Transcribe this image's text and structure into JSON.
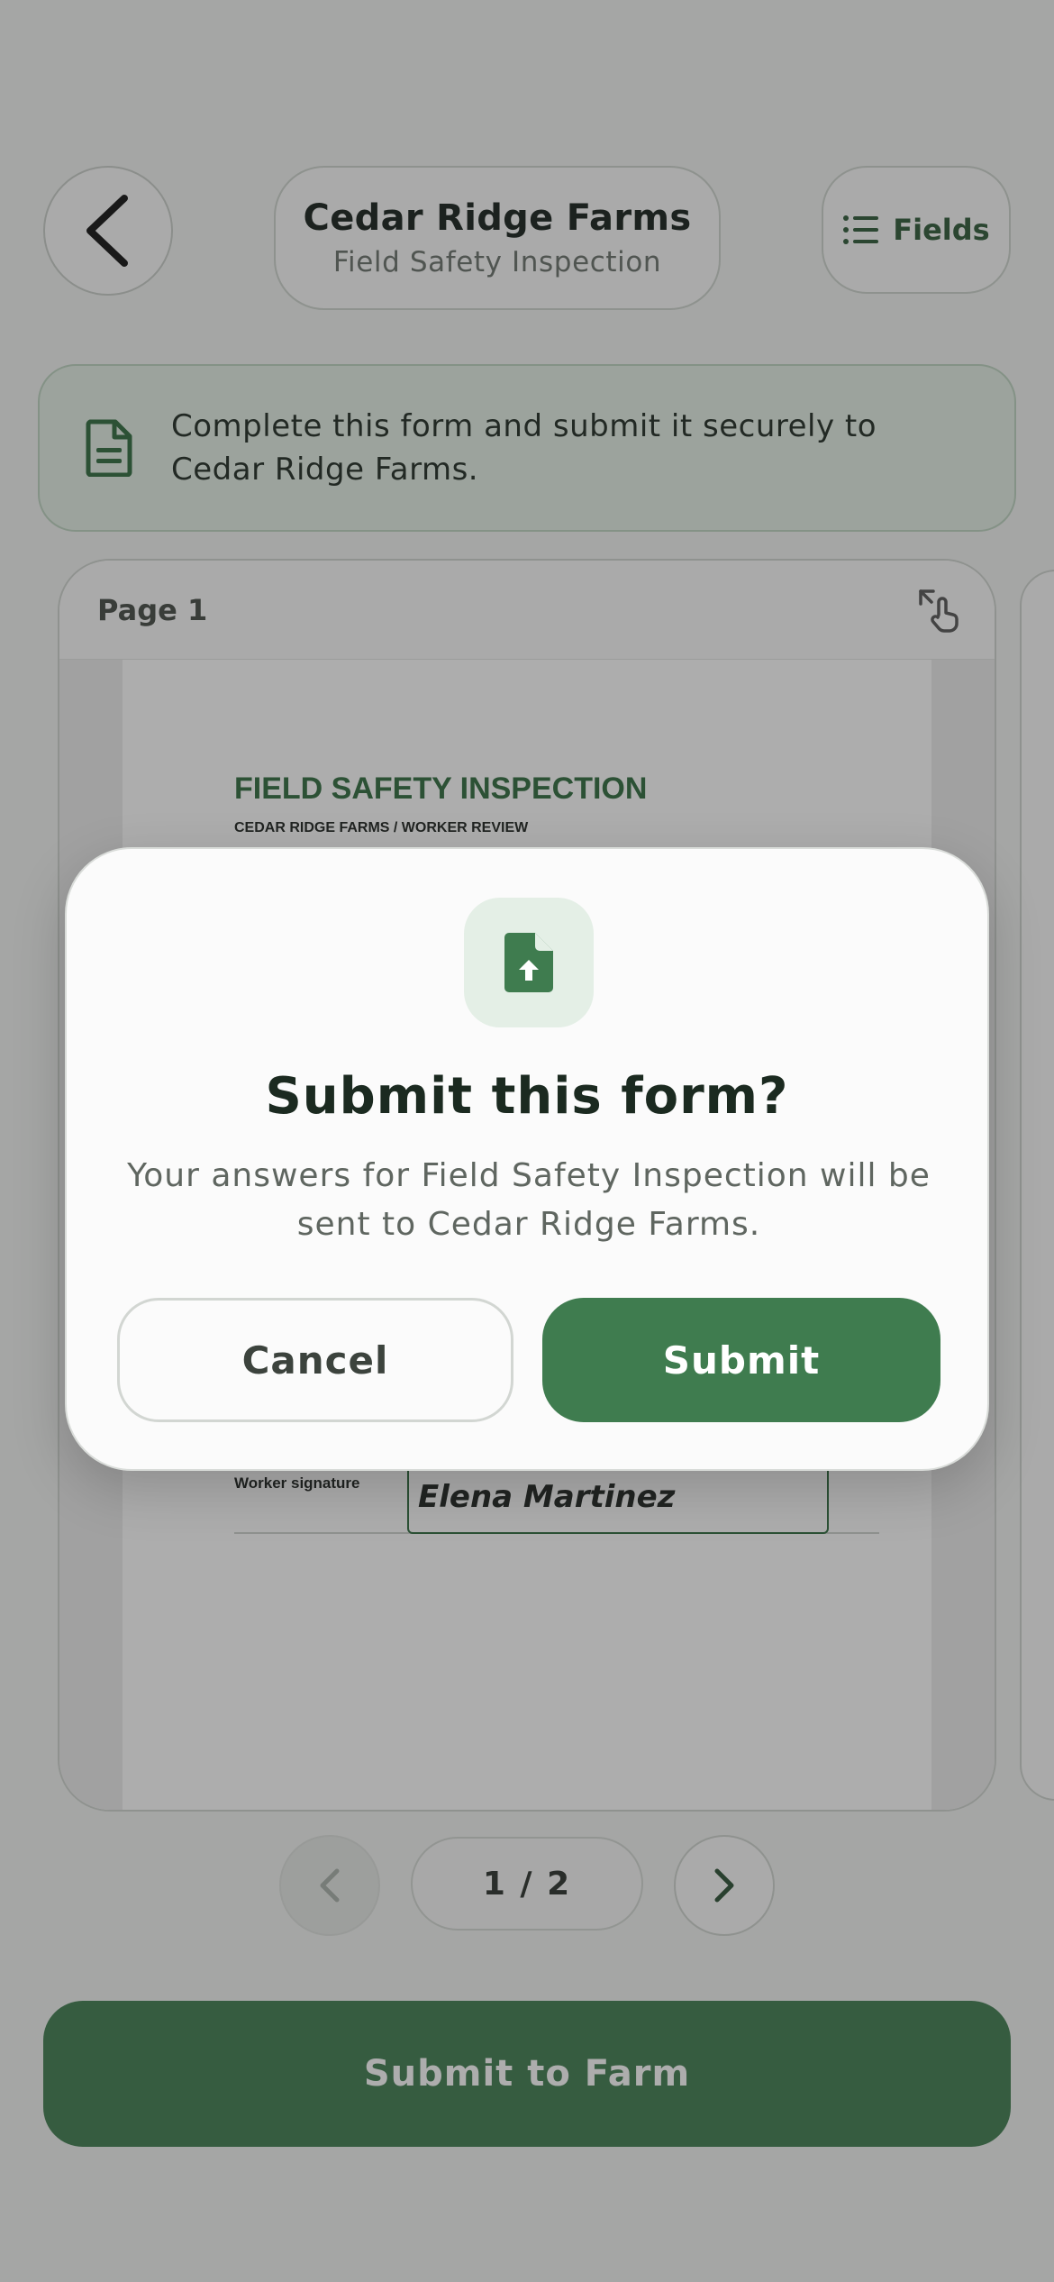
{
  "header": {
    "org_name": "Cedar Ridge Farms",
    "form_name": "Field Safety Inspection",
    "fields_label": "Fields"
  },
  "banner": {
    "text": "Complete this form and submit it securely to Cedar Ridge Farms."
  },
  "preview": {
    "page_label": "Page 1",
    "doc_title": "FIELD SAFETY INSPECTION",
    "doc_subtitle": "CEDAR RIDGE FARMS / WORKER REVIEW",
    "signature_label": "Worker signature",
    "signature_value": "Elena Martinez"
  },
  "pager": {
    "text": "1 / 2"
  },
  "cta": {
    "label": "Submit to Farm"
  },
  "modal": {
    "title": "Submit this form?",
    "body": "Your answers for Field Safety Inspection will be sent to Cedar Ridge Farms.",
    "cancel_label": "Cancel",
    "submit_label": "Submit"
  },
  "icons": {
    "back": "chevron-left-icon",
    "fields": "list-icon",
    "banner": "document-icon",
    "expand": "expand-touch-icon",
    "pager_prev": "chevron-left-icon",
    "pager_next": "chevron-right-icon",
    "modal": "file-upload-icon"
  },
  "colors": {
    "brand_green": "#3f7c4f",
    "banner_bg": "#e4efe6",
    "doc_heading": "#2f6b3e"
  }
}
